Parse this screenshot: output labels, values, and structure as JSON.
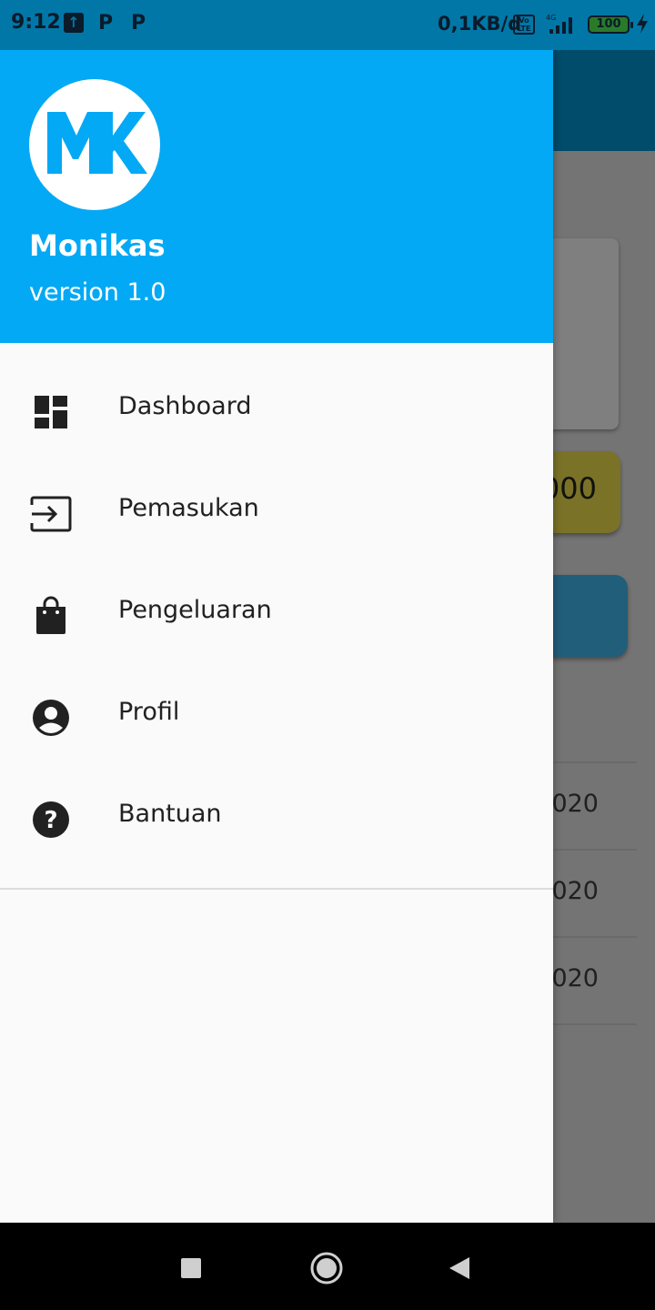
{
  "status_bar": {
    "time": "9:12",
    "net_speed": "0,1KB/d",
    "volte_label": "Vo LTE",
    "battery_level": "100",
    "notification_icons": [
      "upload-notification-icon",
      "p-app-icon",
      "p-app-icon"
    ]
  },
  "drawer": {
    "header": {
      "logo_text": "MK",
      "app_name": "Monikas",
      "version": "version 1.0",
      "background_color": "#03a9f4"
    },
    "menu": [
      {
        "label": "Dashboard",
        "icon": "dashboard-icon"
      },
      {
        "label": "Pemasukan",
        "icon": "input-icon"
      },
      {
        "label": "Pengeluaran",
        "icon": "shopping-bag-icon"
      },
      {
        "label": "Profil",
        "icon": "account-circle-icon"
      },
      {
        "label": "Bantuan",
        "icon": "help-icon"
      }
    ]
  },
  "background": {
    "card_amount_fragment": "000",
    "date_fragments": [
      "020",
      "020",
      "020"
    ]
  },
  "nav_bar": {
    "buttons": [
      "recents-button",
      "home-button",
      "back-button"
    ]
  }
}
